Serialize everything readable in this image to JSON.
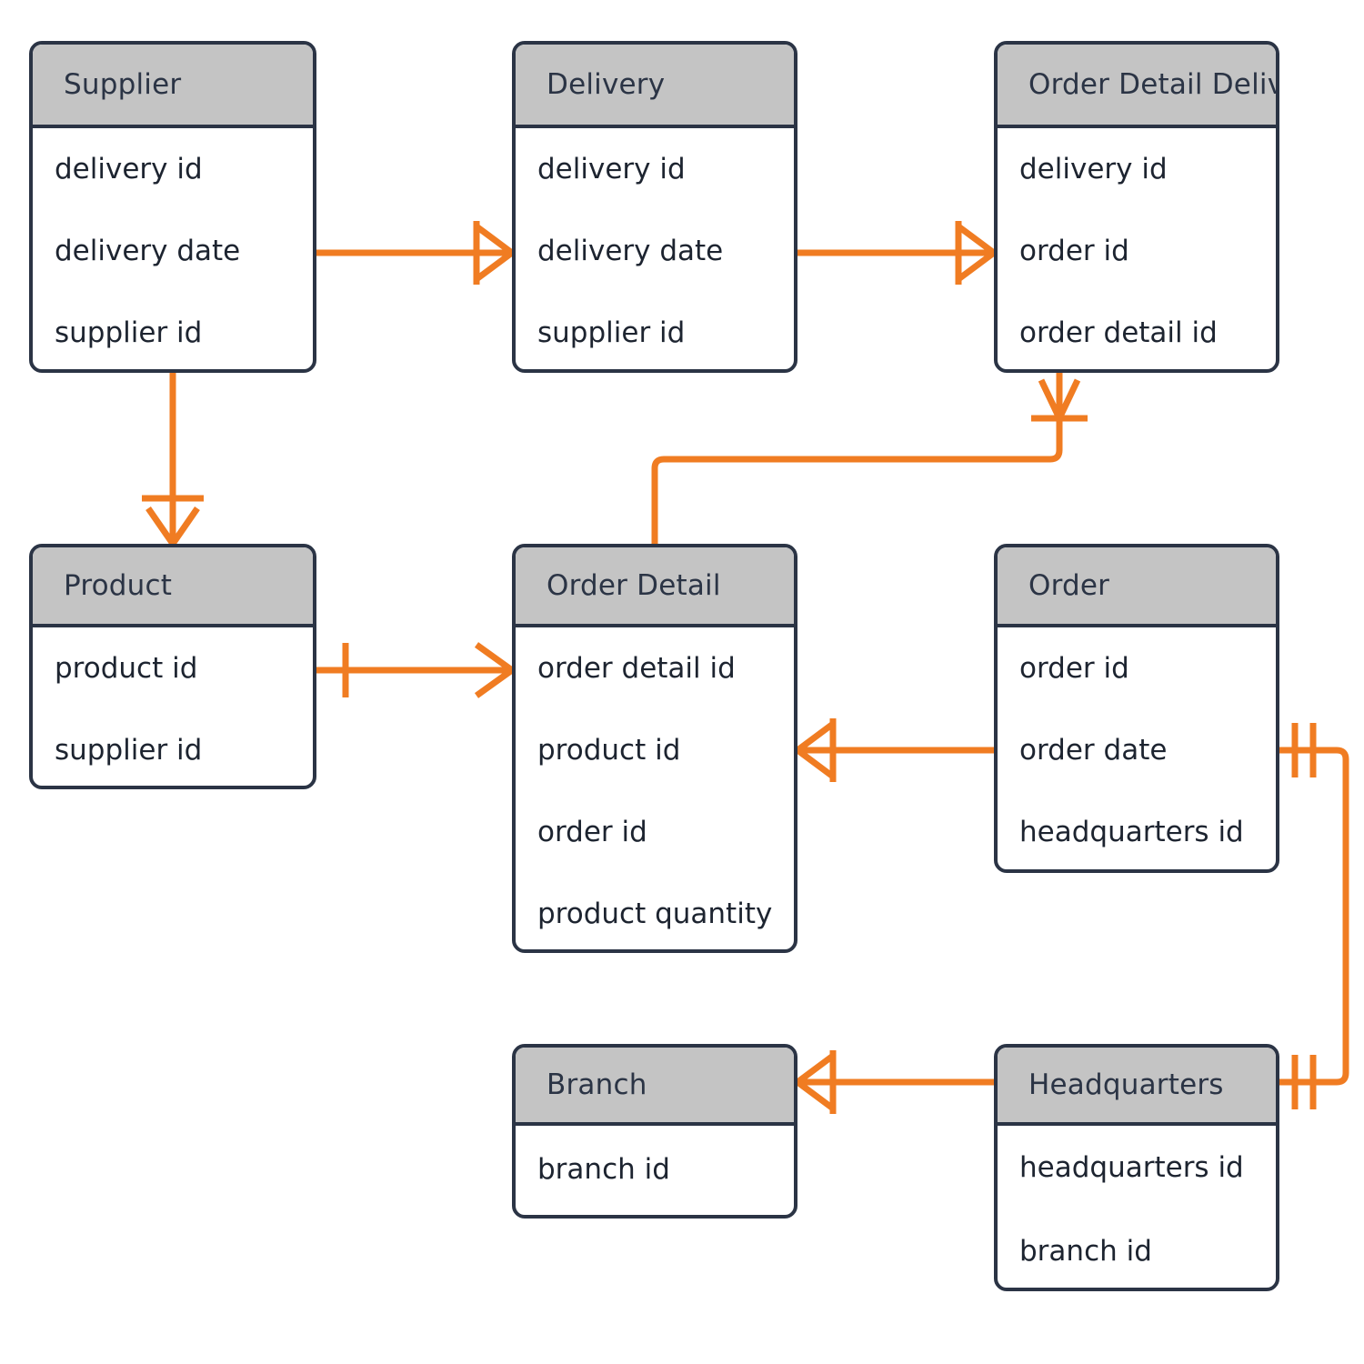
{
  "diagram": {
    "type": "entity-relationship-diagram",
    "notation": "crows-foot",
    "colors": {
      "line": "#f07c22",
      "entity_border": "#2b3445",
      "header_fill": "#c4c4c4",
      "body_fill": "#ffffff",
      "text": "#1d2430",
      "background": "#ffffff"
    }
  },
  "entities": [
    {
      "id": "supplier",
      "name": "Supplier",
      "attributes": [
        "delivery id",
        "delivery date",
        "supplier id"
      ]
    },
    {
      "id": "delivery",
      "name": "Delivery",
      "attributes": [
        "delivery id",
        "delivery date",
        "supplier id"
      ]
    },
    {
      "id": "order_detail_delivery",
      "name": "Order Detail Delivery",
      "attributes": [
        "delivery id",
        "order id",
        "order detail id"
      ]
    },
    {
      "id": "product",
      "name": "Product",
      "attributes": [
        "product id",
        "supplier id"
      ]
    },
    {
      "id": "order_detail",
      "name": "Order Detail",
      "attributes": [
        "order detail id",
        "product id",
        "order id",
        "product quantity"
      ]
    },
    {
      "id": "order",
      "name": "Order",
      "attributes": [
        "order id",
        "order date",
        "headquarters id"
      ]
    },
    {
      "id": "branch",
      "name": "Branch",
      "attributes": [
        "branch id"
      ]
    },
    {
      "id": "headquarters",
      "name": "Headquarters",
      "attributes": [
        "headquarters id",
        "branch id"
      ]
    }
  ],
  "relationships": [
    {
      "id": "supplier-delivery",
      "from": "supplier",
      "to": "delivery",
      "from_cardinality": "one",
      "to_cardinality": "many"
    },
    {
      "id": "delivery-order-detail-delivery",
      "from": "delivery",
      "to": "order_detail_delivery",
      "from_cardinality": "one",
      "to_cardinality": "many"
    },
    {
      "id": "supplier-product",
      "from": "supplier",
      "to": "product",
      "from_cardinality": "one",
      "to_cardinality": "many"
    },
    {
      "id": "order-detail-delivery-order-detail",
      "from": "order_detail_delivery",
      "to": "order_detail",
      "from_cardinality": "many",
      "to_cardinality": "one"
    },
    {
      "id": "product-order-detail",
      "from": "product",
      "to": "order_detail",
      "from_cardinality": "one",
      "to_cardinality": "many"
    },
    {
      "id": "order-detail-order",
      "from": "order_detail",
      "to": "order",
      "from_cardinality": "many",
      "to_cardinality": "one"
    },
    {
      "id": "branch-headquarters",
      "from": "branch",
      "to": "headquarters",
      "from_cardinality": "many",
      "to_cardinality": "one"
    },
    {
      "id": "order-headquarters",
      "from": "order",
      "to": "headquarters",
      "from_cardinality": "one-and-only-one",
      "to_cardinality": "one-and-only-one"
    }
  ]
}
